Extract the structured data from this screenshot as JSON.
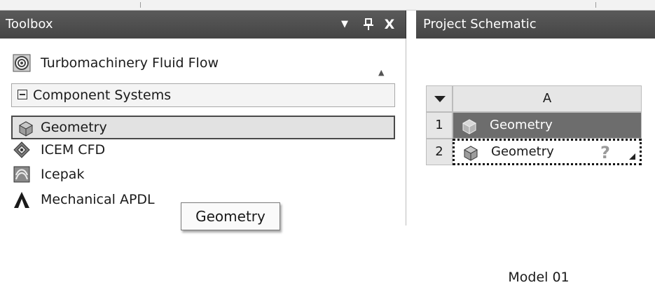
{
  "toolbox": {
    "title": "Toolbox",
    "controls": {
      "dropdown": "▼",
      "pin": "ꟼ",
      "close": "X"
    },
    "items": [
      {
        "label": "Turbomachinery Fluid Flow",
        "icon": "turbomachinery-icon"
      }
    ],
    "group": {
      "label": "Component Systems",
      "toggle": "minus",
      "expanded": true
    },
    "components": [
      {
        "label": "Geometry",
        "icon": "geometry-cube-icon",
        "selected": true
      },
      {
        "label": "ICEM CFD",
        "icon": "icem-cfd-icon"
      },
      {
        "label": "Icepak",
        "icon": "icepak-icon"
      },
      {
        "label": "Mechanical APDL",
        "icon": "mechanical-apdl-icon"
      }
    ],
    "tooltip": "Geometry"
  },
  "schematic": {
    "title": "Project Schematic",
    "system": {
      "column_header": "A",
      "rows": [
        {
          "num": "1",
          "label": "Geometry",
          "status": ""
        },
        {
          "num": "2",
          "label": "Geometry",
          "status": "?"
        }
      ],
      "caption": "Model 01"
    }
  },
  "colors": {
    "header_bg": "#4f4f4f",
    "selected_row_bg": "#6d6d6d",
    "cell_bg": "#e6e6e6"
  }
}
